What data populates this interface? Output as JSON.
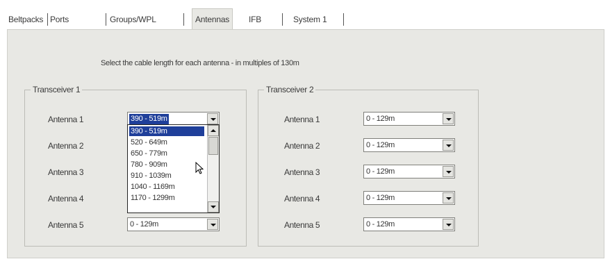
{
  "tabs": [
    {
      "label": "Beltpacks"
    },
    {
      "label": "Ports"
    },
    {
      "label": "Groups/WPL"
    },
    {
      "label": "Antennas"
    },
    {
      "label": "IFB"
    },
    {
      "label": "System 1"
    }
  ],
  "instruction": "Select the cable length for each antenna - in multiples of 130m",
  "transceiver1": {
    "title": "Transceiver 1",
    "antennas": [
      {
        "label": "Antenna 1",
        "value": "390 - 519m"
      },
      {
        "label": "Antenna 2",
        "value": ""
      },
      {
        "label": "Antenna 3",
        "value": ""
      },
      {
        "label": "Antenna 4",
        "value": ""
      },
      {
        "label": "Antenna 5",
        "value": "0 - 129m"
      }
    ]
  },
  "transceiver2": {
    "title": "Transceiver 2",
    "antennas": [
      {
        "label": "Antenna 1",
        "value": "0 - 129m"
      },
      {
        "label": "Antenna 2",
        "value": "0 - 129m"
      },
      {
        "label": "Antenna 3",
        "value": "0 - 129m"
      },
      {
        "label": "Antenna 4",
        "value": "0 - 129m"
      },
      {
        "label": "Antenna 5",
        "value": "0 - 129m"
      }
    ]
  },
  "dropdown_options": [
    "390 - 519m",
    "520 - 649m",
    "650 - 779m",
    "780 - 909m",
    "910 - 1039m",
    "1040 - 1169m",
    "1170 - 1299m"
  ],
  "colors": {
    "selection": "#1f3f9a",
    "panel": "#e8e8e4"
  },
  "icons": {
    "combo_button": "chevron-down-icon",
    "cursor": "mouse-pointer-icon"
  }
}
